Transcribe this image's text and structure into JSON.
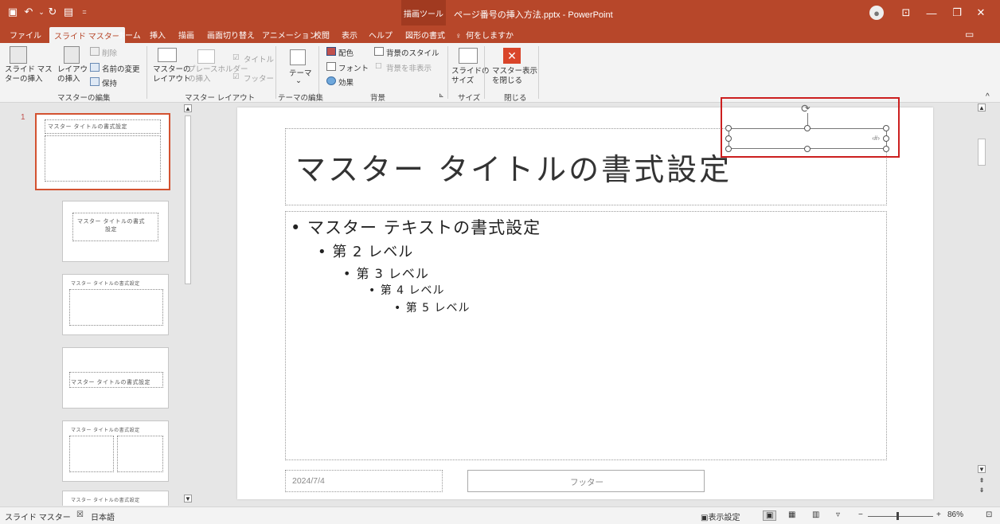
{
  "titlebar": {
    "context_tool": "描画ツール",
    "doc_title": "ページ番号の挿入方法.pptx  -  PowerPoint",
    "qa_icons": [
      "save-icon",
      "undo-icon",
      "redo-icon",
      "present-icon",
      "customize-icon"
    ]
  },
  "tabs": [
    "ファイル",
    "スライド マスター",
    "ホーム",
    "挿入",
    "描画",
    "画面切り替え",
    "アニメーション",
    "校閲",
    "表示",
    "ヘルプ",
    "図形の書式"
  ],
  "tell_me": "何をしますか",
  "ribbon": {
    "insert_master": "スライド マス\nターの挿入",
    "insert_layout": "レイアウト\nの挿入",
    "delete": "削除",
    "rename": "名前の変更",
    "preserve": "保持",
    "group_edit_master": "マスターの編集",
    "master_layout": "マスターの\nレイアウト",
    "insert_placeholder": "プレースホルダー\nの挿入",
    "title_chk": "タイトル",
    "footer_chk": "フッター",
    "group_master_layout": "マスター レイアウト",
    "theme": "テーマ",
    "group_edit_theme": "テーマの編集",
    "colors": "配色",
    "fonts": "フォント",
    "effects": "効果",
    "bg_styles": "背景のスタイル",
    "hide_bg": "背景を非表示",
    "group_background": "背景",
    "slide_size": "スライドの\nサイズ",
    "group_size": "サイズ",
    "close_master": "マスター表示\nを閉じる",
    "group_close": "閉じる"
  },
  "thumbs": {
    "number": "1",
    "title1": "マスター タイトルの書式設定",
    "title2": "マスター タイトルの書式\n設定",
    "title3": "マスター タイトルの書式設定",
    "title4": "マスター タイトルの書式設定",
    "title5": "マスター タイトルの書式設定",
    "title6": "マスター タイトルの書式設定"
  },
  "slide": {
    "title": "マスター タイトルの書式設定",
    "bullets": [
      {
        "text": "• マスター テキストの書式設定"
      },
      {
        "text": "• 第 2 レベル"
      },
      {
        "text": "• 第 3 レベル"
      },
      {
        "text": "• 第 4 レベル"
      },
      {
        "text": "• 第 5 レベル"
      }
    ],
    "date": "2024/7/4",
    "footer": "フッター",
    "page_number": "‹#›"
  },
  "status": {
    "view": "スライド マスター",
    "language": "日本語",
    "display_settings": "表示設定",
    "zoom": "86%"
  }
}
